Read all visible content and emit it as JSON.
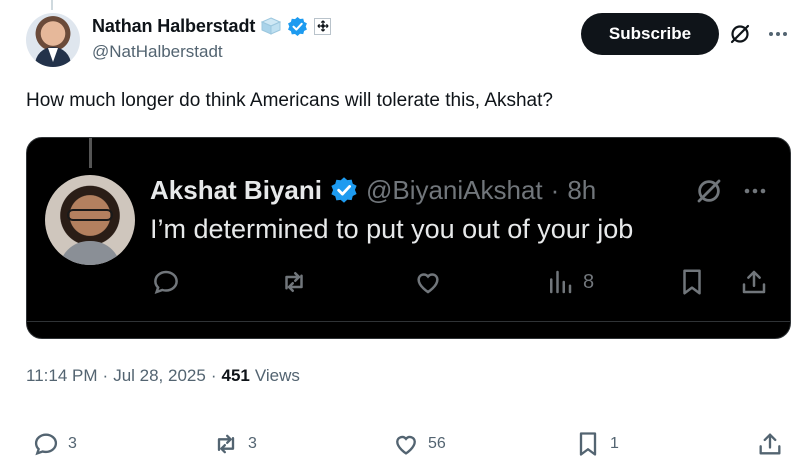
{
  "author": {
    "display_name": "Nathan Halberstadt",
    "handle": "@NatHalberstadt"
  },
  "header": {
    "subscribe_label": "Subscribe"
  },
  "tweet": {
    "text": "How much longer do think Americans will tolerate this, Akshat?",
    "time": "11:14 PM",
    "date": "Jul 28, 2025",
    "views_count": "451",
    "views_label": "Views"
  },
  "quoted": {
    "display_name": "Akshat Biyani",
    "handle": "@BiyaniAkshat",
    "time": "8h",
    "text": "I’m determined to put you out of your job",
    "views": "8"
  },
  "actions": {
    "replies": "3",
    "reposts": "3",
    "likes": "56",
    "bookmarks": "1"
  },
  "colors": {
    "verified_blue": "#1d9bf0",
    "text_primary": "#0f1419",
    "text_secondary": "#536471",
    "media_bg": "#000000"
  },
  "icons": [
    "grok-icon",
    "more-icon",
    "verified-icon",
    "reply-icon",
    "repost-icon",
    "like-icon",
    "views-icon",
    "bookmark-icon",
    "share-icon"
  ]
}
